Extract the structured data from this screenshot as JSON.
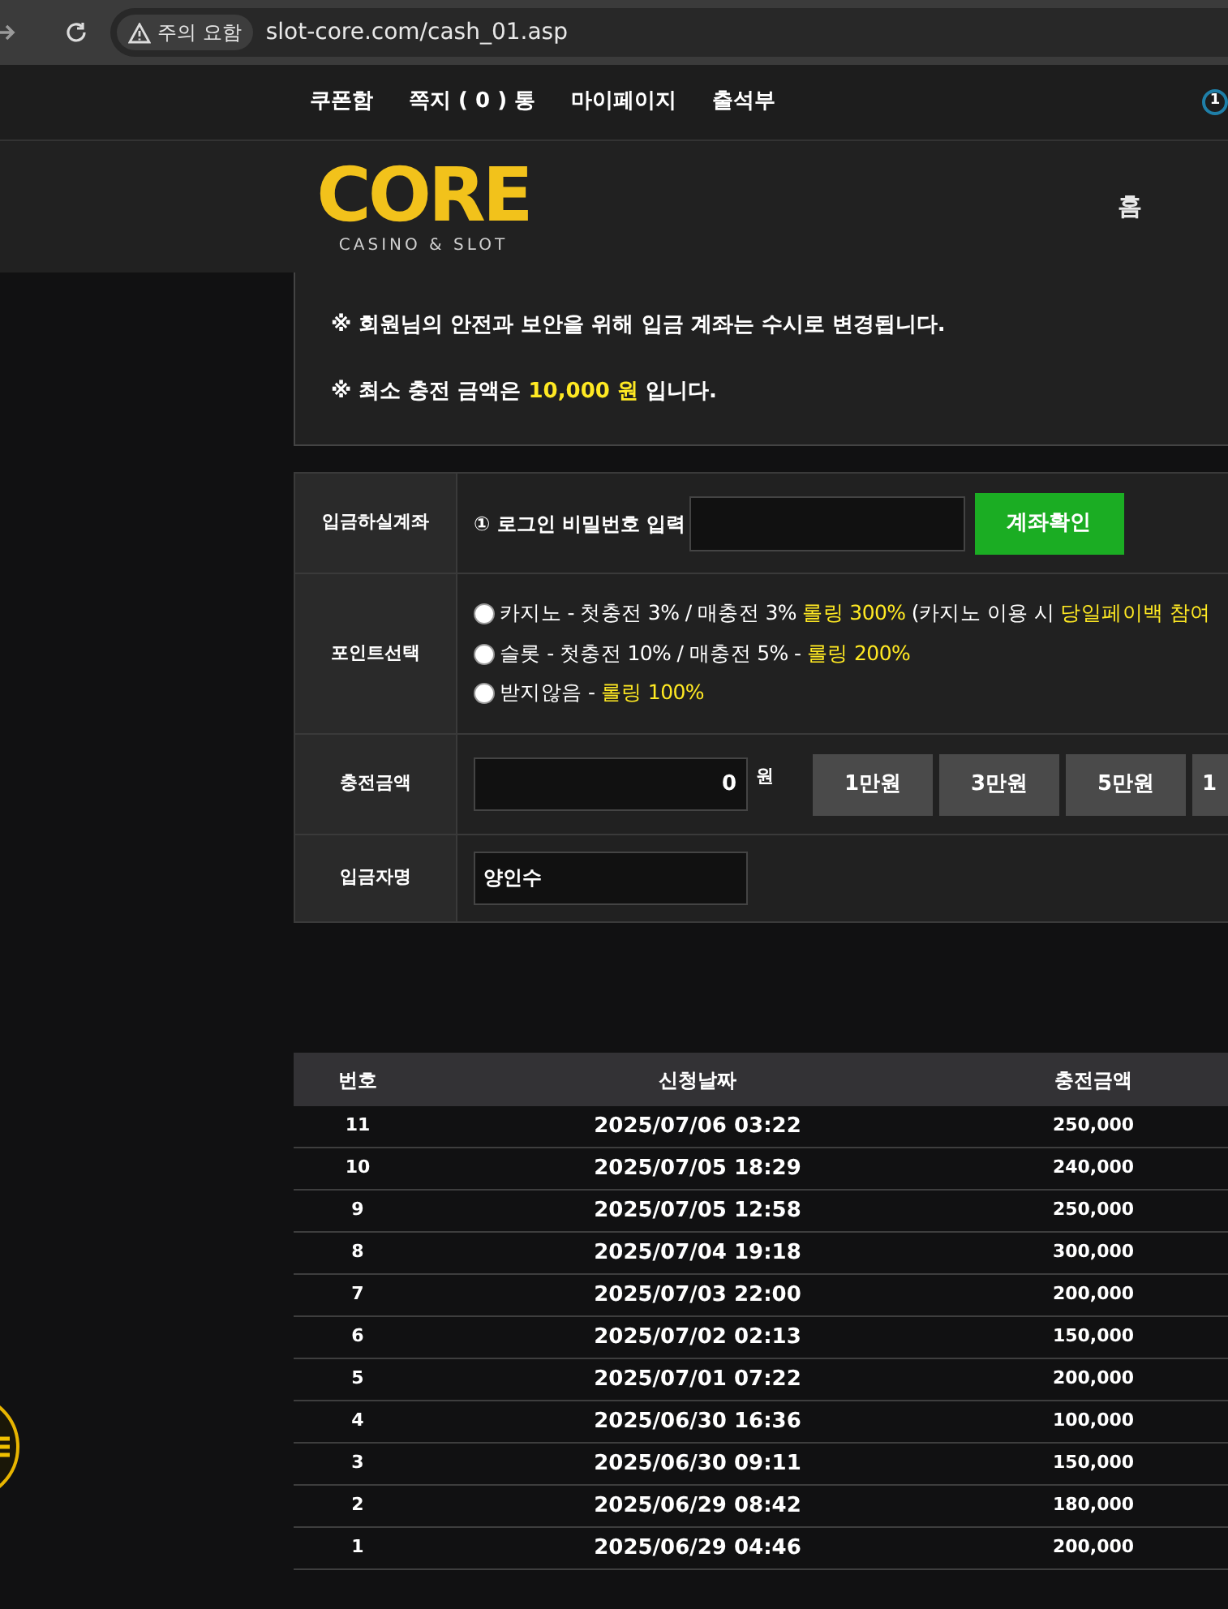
{
  "browser": {
    "security_label": "주의 요함",
    "url": "slot-core.com/cash_01.asp"
  },
  "top_nav": {
    "items": [
      "쿠폰함",
      "쪽지 ( 0 ) 통",
      "마이페이지",
      "출석부"
    ],
    "badge": "1"
  },
  "header": {
    "logo": "CORE",
    "logo_subtitle": "CASINO & SLOT",
    "menu": [
      "홈"
    ]
  },
  "notices": [
    [
      {
        "text": "※ 회원님의 안전과 보안을 위해 입금 계좌는 수시로 변경됩니다.",
        "highlight": false
      }
    ],
    [
      {
        "text": "※ 최소 충전 금액은 ",
        "highlight": false
      },
      {
        "text": "10,000 원",
        "highlight": true
      },
      {
        "text": " 입니다.",
        "highlight": false
      }
    ]
  ],
  "form": {
    "account": {
      "label": "입금하실계좌",
      "prompt": "① 로그인 비밀번호 입력",
      "button": "계좌확인"
    },
    "points": {
      "label": "포인트선택",
      "options": [
        {
          "checked": false,
          "parts": [
            {
              "text": "카지노 - 첫충전 3% / 매충전 3% ",
              "highlight": false
            },
            {
              "text": "롤링 300%",
              "highlight": true
            },
            {
              "text": " (카지노 이용 시 ",
              "highlight": false
            },
            {
              "text": "당일페이백 참여",
              "highlight": true
            }
          ]
        },
        {
          "checked": false,
          "parts": [
            {
              "text": "슬롯 - 첫충전 10% / 매충전 5% - ",
              "highlight": false
            },
            {
              "text": "롤링 200%",
              "highlight": true
            }
          ]
        },
        {
          "checked": false,
          "parts": [
            {
              "text": "받지않음 - ",
              "highlight": false
            },
            {
              "text": "롤링 100%",
              "highlight": true
            }
          ]
        }
      ]
    },
    "amount": {
      "label": "충전금액",
      "value": "0",
      "unit": "원",
      "quick_buttons": [
        "1만원",
        "3만원",
        "5만원",
        "1"
      ]
    },
    "depositor": {
      "label": "입금자명",
      "value": "양인수"
    }
  },
  "history": {
    "columns": [
      "번호",
      "신청날짜",
      "충전금액"
    ],
    "rows": [
      [
        "11",
        "2025/07/06 03:22",
        "250,000"
      ],
      [
        "10",
        "2025/07/05 18:29",
        "240,000"
      ],
      [
        "9",
        "2025/07/05 12:58",
        "250,000"
      ],
      [
        "8",
        "2025/07/04 19:18",
        "300,000"
      ],
      [
        "7",
        "2025/07/03 22:00",
        "200,000"
      ],
      [
        "6",
        "2025/07/02 02:13",
        "150,000"
      ],
      [
        "5",
        "2025/07/01 07:22",
        "200,000"
      ],
      [
        "4",
        "2025/06/30 16:36",
        "100,000"
      ],
      [
        "3",
        "2025/06/30 09:11",
        "150,000"
      ],
      [
        "2",
        "2025/06/29 08:42",
        "180,000"
      ],
      [
        "1",
        "2025/06/29 04:46",
        "200,000"
      ]
    ]
  }
}
